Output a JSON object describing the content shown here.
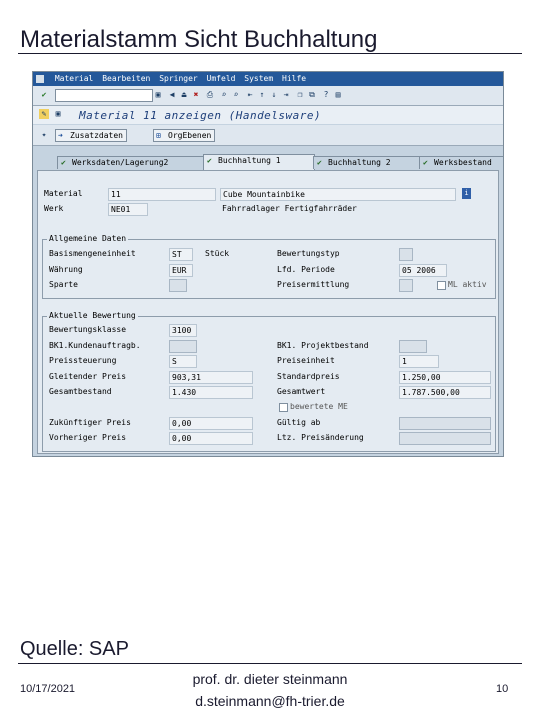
{
  "slide": {
    "title": "Materialstamm Sicht Buchhaltung",
    "source": "Quelle: SAP",
    "date": "10/17/2021",
    "author_line1": "prof. dr. dieter steinmann",
    "author_line2": "d.steinmann@fh-trier.de",
    "page_number": "10"
  },
  "sap": {
    "menu": [
      "Material",
      "Bearbeiten",
      "Springer",
      "Umfeld",
      "System",
      "Hilfe"
    ],
    "title": "Material 11 anzeigen (Handelsware)",
    "app_buttons": [
      "Zusatzdaten",
      "OrgEbenen"
    ],
    "tabs": [
      "Werksdaten/Lagerung2",
      "Buchhaltung 1",
      "Buchhaltung 2",
      "Werksbestand"
    ],
    "header": {
      "material_label": "Material",
      "material_value": "11",
      "material_desc": "Cube Mountainbike",
      "werk_label": "Werk",
      "werk_value": "NE01",
      "werk_desc": "Fahrradlager Fertigfahrräder"
    },
    "general": {
      "title": "Allgemeine Daten",
      "basis_label": "Basismengeneinheit",
      "basis_value": "ST",
      "basis_text": "Stück",
      "waehrung_label": "Währung",
      "waehrung_value": "EUR",
      "sparte_label": "Sparte",
      "bewertungstyp_label": "Bewertungstyp",
      "periode_label": "Lfd. Periode",
      "periode_value": "05 2006",
      "preisermittlung_label": "Preisermittlung",
      "ml_aktiv_label": "ML aktiv"
    },
    "valuation": {
      "title": "Aktuelle Bewertung",
      "bewertungsklasse_label": "Bewertungsklasse",
      "bewertungsklasse_value": "3100",
      "kundenauftrag_label": "BK1.Kundenauftragb.",
      "projektbestand_label": "BK1. Projektbestand",
      "preissteuerung_label": "Preissteuerung",
      "preissteuerung_value": "S",
      "preiseinheit_label": "Preiseinheit",
      "preiseinheit_value": "1",
      "gleitender_label": "Gleitender Preis",
      "gleitender_value": "903,31",
      "standardpreis_label": "Standardpreis",
      "standardpreis_value": "1.250,00",
      "gesamtbestand_label": "Gesamtbestand",
      "gesamtbestand_value": "1.430",
      "gesamtwert_label": "Gesamtwert",
      "gesamtwert_value": "1.787.500,00",
      "bewertete_me_label": "bewertete ME",
      "zukuenftiger_label": "Zukünftiger Preis",
      "zukuenftiger_value": "0,00",
      "gueltig_label": "Gültig ab",
      "vorheriger_label": "Vorheriger Preis",
      "vorheriger_value": "0,00",
      "ltz_label": "Ltz. Preisänderung"
    }
  }
}
